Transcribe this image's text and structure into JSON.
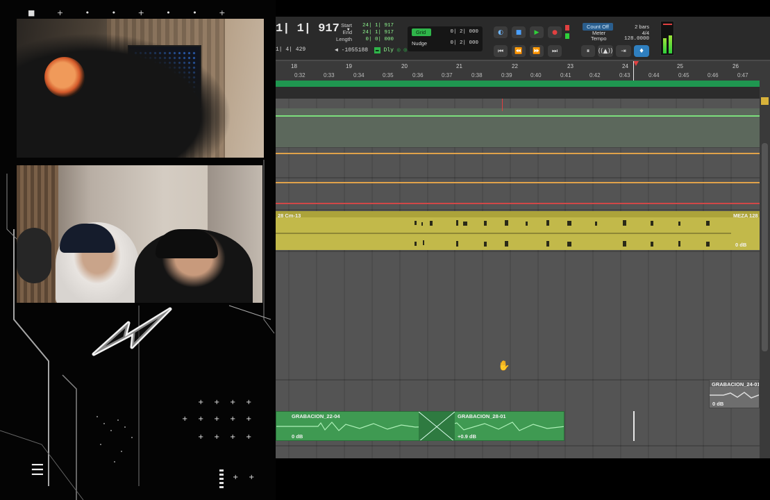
{
  "overlay": {
    "menu_glyph": "☰"
  },
  "counter": {
    "main": "1| 1| 917",
    "sub": "1| 4| 429",
    "selection": {
      "start_label": "Start",
      "start_value": "24| 1| 917",
      "end_label": "End",
      "end_value": "24| 1| 917",
      "length_label": "Length",
      "length_value": "0| 0| 000"
    },
    "offset": "-1055188",
    "dly_label": "Dly"
  },
  "grid": {
    "grid_label": "Grid",
    "grid_value": "0| 2| 000",
    "nudge_label": "Nudge",
    "nudge_value": "0| 2| 000"
  },
  "transport": {
    "buttons": [
      "online-icon",
      "stop-icon",
      "play-icon",
      "record-icon",
      "rtz-icon",
      "rewind-icon",
      "fast-forward-icon",
      "goto-end-icon"
    ]
  },
  "count": {
    "count_off_label": "Count Off",
    "bars_value": "2 bars",
    "meter_label": "Meter",
    "meter_value": "4/4",
    "tempo_label": "Tempo",
    "tempo_value": "128.0000"
  },
  "ruler": {
    "bars": [
      "18",
      "19",
      "20",
      "21",
      "22",
      "23",
      "24",
      "25",
      "26"
    ],
    "times": [
      "0:32",
      "0:33",
      "0:34",
      "0:35",
      "0:36",
      "0:37",
      "0:38",
      "0:39",
      "0:40",
      "0:41",
      "0:42",
      "0:43",
      "0:44",
      "0:45",
      "0:46",
      "0:47"
    ]
  },
  "clips": {
    "audio_left_name": "28 Cm-13",
    "audio_right_name": "MEZA 128",
    "audio_right_gain": "0 dB",
    "grab1_name": "GRABACION_22-04",
    "grab1_gain": "0 dB",
    "grab2_name": "GRABACION_28-01",
    "grab2_gain": "+0.9 dB",
    "grab3_name": "GRABACION_24-01",
    "grab3_gain": "0 dB"
  },
  "colors": {
    "audio_clip": "#c2b94a",
    "rec_clip": "#3f9a52",
    "timeline_green": "#1f9650",
    "counter_green": "#8ff78f",
    "play_green": "#2fcf3a",
    "record_red": "#e04040"
  }
}
